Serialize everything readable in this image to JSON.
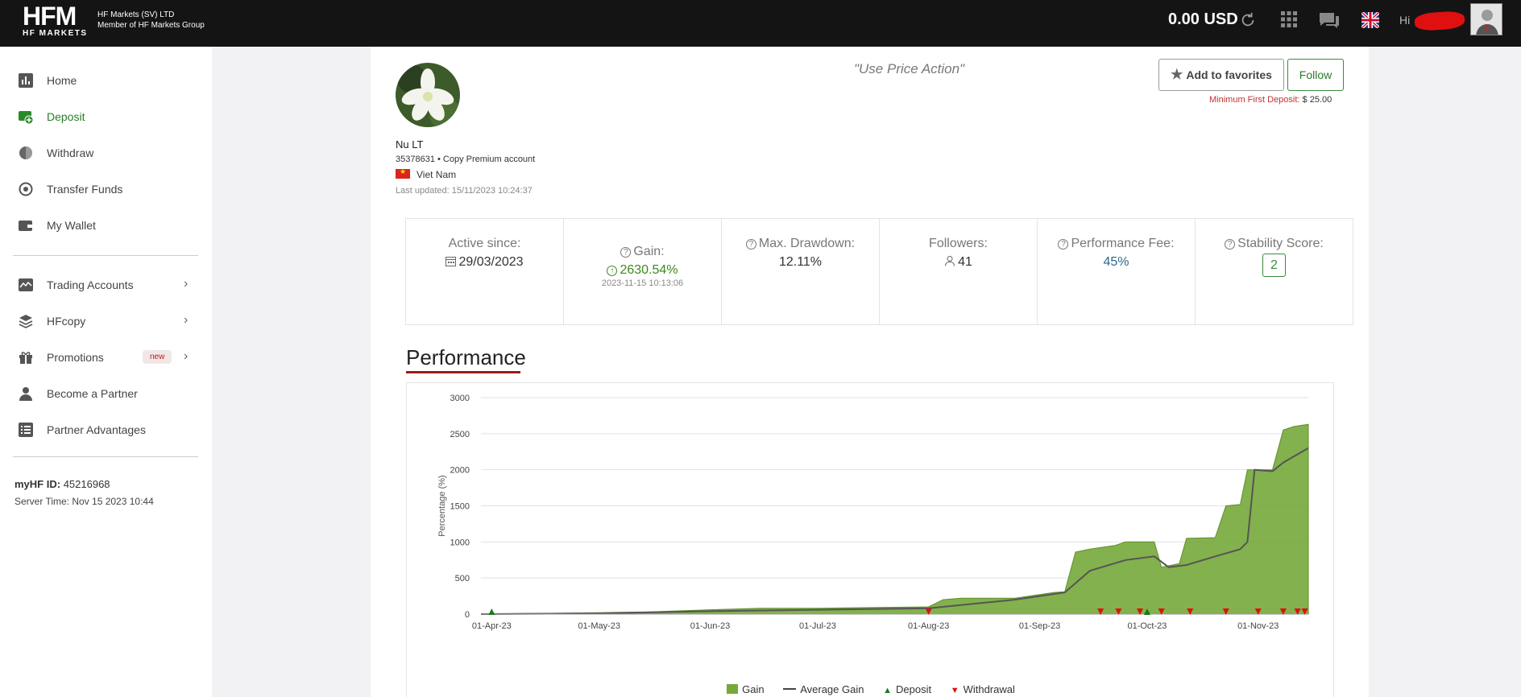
{
  "header": {
    "logo_text": "HFM",
    "logo_sub": "HF MARKETS",
    "company_line1": "HF Markets (SV) LTD",
    "company_line2": "Member of HF Markets Group",
    "balance": "0.00 USD",
    "greeting": "Hi",
    "icons": [
      "refresh-icon",
      "apps-grid-icon",
      "chat-icon",
      "uk-flag-icon",
      "user-avatar"
    ]
  },
  "sidebar": {
    "items": [
      {
        "label": "Home",
        "icon": "chart-icon"
      },
      {
        "label": "Deposit",
        "icon": "deposit-icon",
        "active": true
      },
      {
        "label": "Withdraw",
        "icon": "withdraw-icon"
      },
      {
        "label": "Transfer Funds",
        "icon": "transfer-icon"
      },
      {
        "label": "My Wallet",
        "icon": "wallet-icon"
      },
      {
        "label": "Trading Accounts",
        "icon": "trading-icon"
      },
      {
        "label": "HFcopy",
        "icon": "layers-icon"
      },
      {
        "label": "Promotions",
        "icon": "gift-icon",
        "badge": "new"
      },
      {
        "label": "Become a Partner",
        "icon": "person-icon"
      },
      {
        "label": "Partner Advantages",
        "icon": "list-icon"
      }
    ],
    "myhf_label": "myHF ID:",
    "myhf_id": "45216968",
    "server_time": "Server Time: Nov 15 2023 10:44"
  },
  "profile": {
    "name": "Nu LT",
    "account": "35378631 • Copy Premium account",
    "country": "Viet Nam",
    "last_updated": "Last updated: 15/11/2023 10:24:37",
    "tagline": "\"Use Price Action\"",
    "add_favorites": "Add to favorites",
    "follow": "Follow",
    "min_deposit_label": "Minimum First Deposit:",
    "min_deposit_value": "$ 25.00"
  },
  "stats": {
    "active_since_title": "Active since:",
    "active_since": "29/03/2023",
    "gain_title": "Gain:",
    "gain": "2630.54%",
    "gain_date": "2023-11-15 10:13:06",
    "drawdown_title": "Max. Drawdown:",
    "drawdown": "12.11%",
    "followers_title": "Followers:",
    "followers": "41",
    "fee_title": "Performance Fee:",
    "fee": "45%",
    "stability_title": "Stability Score:",
    "stability": "2"
  },
  "performance": {
    "title": "Performance"
  },
  "chart_data": {
    "type": "area",
    "title": "",
    "ylabel": "Percentage (%)",
    "xlabel": "",
    "ylim": [
      0,
      3000
    ],
    "yticks": [
      0,
      500,
      1000,
      1500,
      2000,
      2500,
      3000
    ],
    "xticks": [
      "01-Apr-23",
      "01-May-23",
      "01-Jun-23",
      "01-Jul-23",
      "01-Aug-23",
      "01-Sep-23",
      "01-Oct-23",
      "01-Nov-23"
    ],
    "grid": true,
    "legend_position": "bottom",
    "colors": {
      "gain": "#76a83a",
      "average": "#555555",
      "deposit": "#1a7a1a",
      "withdrawal": "#dd1111"
    },
    "series": [
      {
        "name": "Gain",
        "points": [
          [
            "2023-03-29",
            0
          ],
          [
            "2023-04-15",
            10
          ],
          [
            "2023-05-01",
            20
          ],
          [
            "2023-05-15",
            30
          ],
          [
            "2023-06-01",
            60
          ],
          [
            "2023-06-15",
            80
          ],
          [
            "2023-07-01",
            80
          ],
          [
            "2023-07-15",
            90
          ],
          [
            "2023-08-01",
            100
          ],
          [
            "2023-08-05",
            200
          ],
          [
            "2023-08-10",
            220
          ],
          [
            "2023-08-25",
            220
          ],
          [
            "2023-09-05",
            300
          ],
          [
            "2023-09-08",
            310
          ],
          [
            "2023-09-11",
            860
          ],
          [
            "2023-09-15",
            900
          ],
          [
            "2023-09-22",
            950
          ],
          [
            "2023-09-25",
            1000
          ],
          [
            "2023-10-03",
            1000
          ],
          [
            "2023-10-05",
            650
          ],
          [
            "2023-10-10",
            700
          ],
          [
            "2023-10-12",
            1050
          ],
          [
            "2023-10-20",
            1060
          ],
          [
            "2023-10-23",
            1500
          ],
          [
            "2023-10-27",
            1520
          ],
          [
            "2023-10-29",
            2000
          ],
          [
            "2023-11-05",
            2000
          ],
          [
            "2023-11-08",
            2550
          ],
          [
            "2023-11-11",
            2600
          ],
          [
            "2023-11-15",
            2630
          ]
        ]
      },
      {
        "name": "Average Gain",
        "points": [
          [
            "2023-03-29",
            0
          ],
          [
            "2023-05-01",
            10
          ],
          [
            "2023-06-01",
            40
          ],
          [
            "2023-07-01",
            60
          ],
          [
            "2023-08-01",
            80
          ],
          [
            "2023-08-25",
            200
          ],
          [
            "2023-09-08",
            300
          ],
          [
            "2023-09-15",
            600
          ],
          [
            "2023-09-25",
            750
          ],
          [
            "2023-10-03",
            800
          ],
          [
            "2023-10-07",
            650
          ],
          [
            "2023-10-12",
            680
          ],
          [
            "2023-10-20",
            800
          ],
          [
            "2023-10-27",
            900
          ],
          [
            "2023-10-29",
            1000
          ],
          [
            "2023-10-31",
            2000
          ],
          [
            "2023-11-05",
            1980
          ],
          [
            "2023-11-08",
            2100
          ],
          [
            "2023-11-15",
            2300
          ]
        ]
      }
    ],
    "deposits": [
      "2023-04-01",
      "2023-10-01"
    ],
    "withdrawals": [
      "2023-08-01",
      "2023-09-18",
      "2023-09-23",
      "2023-09-29",
      "2023-10-05",
      "2023-10-13",
      "2023-10-23",
      "2023-11-01",
      "2023-11-08",
      "2023-11-12",
      "2023-11-14"
    ]
  },
  "legend": {
    "gain": "Gain",
    "average": "Average Gain",
    "deposit": "Deposit",
    "withdrawal": "Withdrawal"
  }
}
